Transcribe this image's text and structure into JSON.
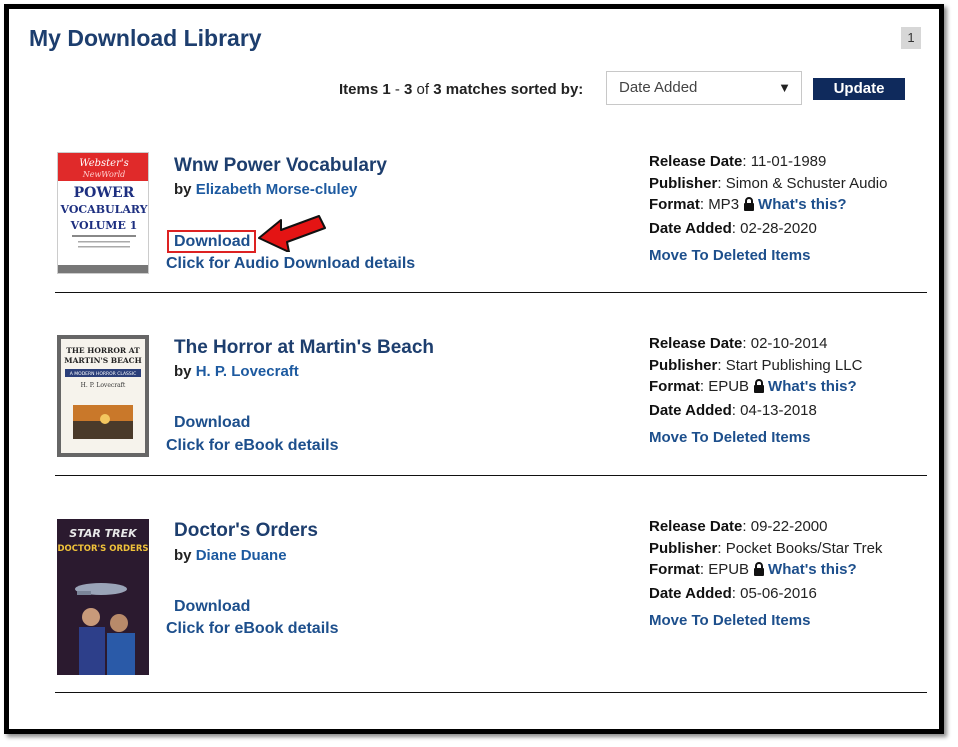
{
  "header": {
    "title": "My Download Library",
    "page_badge": "1"
  },
  "sortbar": {
    "items_prefix": "Items ",
    "range_start": "1",
    "range_dash": " - ",
    "range_end": "3",
    "of_label": " of ",
    "total": "3",
    "suffix": " matches sorted by:",
    "sort_selected": "Date Added",
    "update_label": "Update"
  },
  "labels": {
    "by": "by ",
    "release_date": "Release Date",
    "publisher": "Publisher",
    "format": "Format",
    "date_added": "Date Added",
    "whats_this": "What's this?",
    "move_to_deleted": "Move To Deleted Items",
    "download": "Download"
  },
  "books": [
    {
      "title": "Wnw Power Vocabulary",
      "author": "Elizabeth Morse-cluley",
      "details_link": "Click for Audio Download details",
      "release_date": "11-01-1989",
      "publisher": "Simon & Schuster Audio",
      "format": "MP3",
      "date_added": "02-28-2020",
      "cover_text": [
        "Webster's",
        "NewWorld",
        "POWER",
        "VOCABULARY",
        "VOLUME 1"
      ]
    },
    {
      "title": "The Horror at Martin's Beach",
      "author": "H. P. Lovecraft",
      "details_link": "Click for eBook details",
      "release_date": "02-10-2014",
      "publisher": "Start Publishing LLC",
      "format": "EPUB",
      "date_added": "04-13-2018",
      "cover_text": [
        "THE HORROR AT",
        "MARTIN'S BEACH",
        "A MODERN HORROR CLASSIC",
        "H. P. Lovecraft"
      ]
    },
    {
      "title": "Doctor's Orders",
      "author": "Diane Duane",
      "details_link": "Click for eBook details",
      "release_date": "09-22-2000",
      "publisher": "Pocket Books/Star Trek",
      "format": "EPUB",
      "date_added": "05-06-2016",
      "cover_text": [
        "STAR TREK",
        "DOCTOR'S ORDERS"
      ]
    }
  ],
  "colors": {
    "title_blue": "#1d3e6e",
    "link_blue": "#1d4f8c",
    "update_bg": "#0f2a5c",
    "highlight_red": "#dd2222"
  }
}
